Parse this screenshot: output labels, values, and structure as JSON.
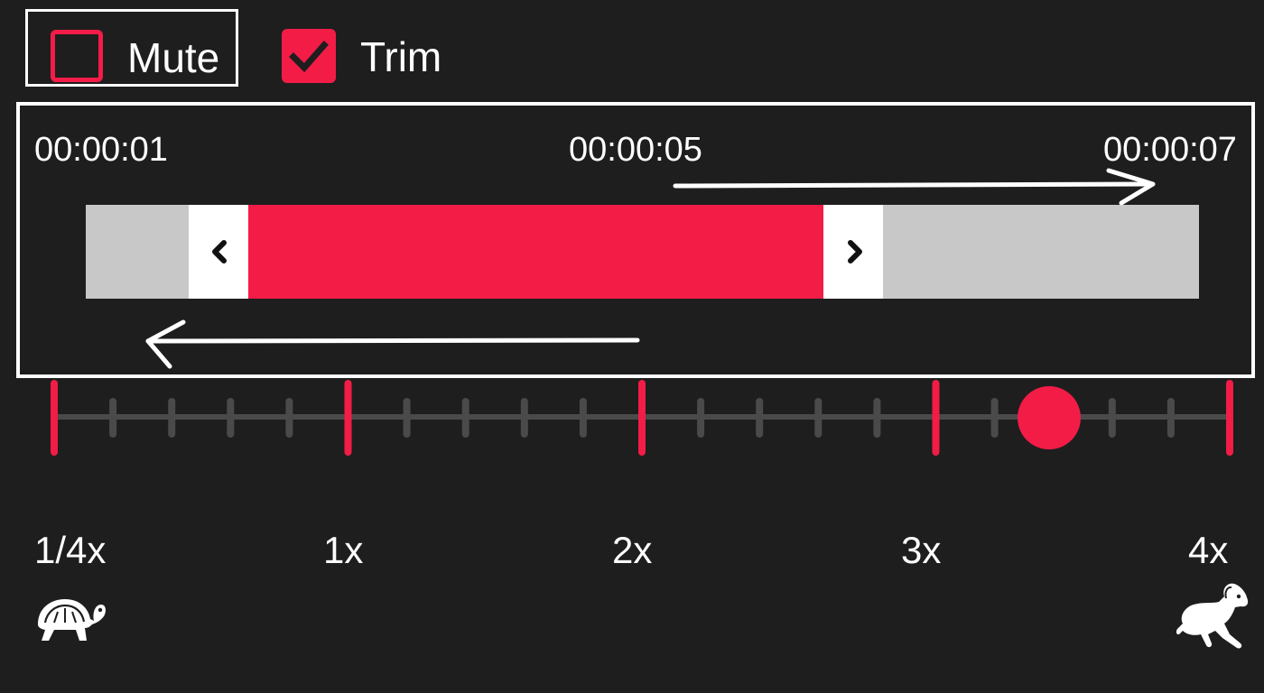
{
  "checkboxes": {
    "mute": {
      "label": "Mute",
      "checked": false
    },
    "trim": {
      "label": "Trim",
      "checked": true
    }
  },
  "trim": {
    "start_time": "00:00:01",
    "current_time": "00:00:05",
    "end_time": "00:00:07",
    "left_handle_icon": "chevron-left-icon",
    "right_handle_icon": "chevron-right-icon"
  },
  "speed": {
    "labels": [
      "1/4x",
      "1x",
      "2x",
      "3x",
      "4x"
    ],
    "slow_icon": "turtle-icon",
    "fast_icon": "rabbit-icon",
    "value_fraction": 0.85
  },
  "colors": {
    "accent": "#f21c47",
    "background": "#1e1e1e",
    "track": "#c8c8c8",
    "text": "#ffffff",
    "slider_line": "#4a4a4a"
  }
}
